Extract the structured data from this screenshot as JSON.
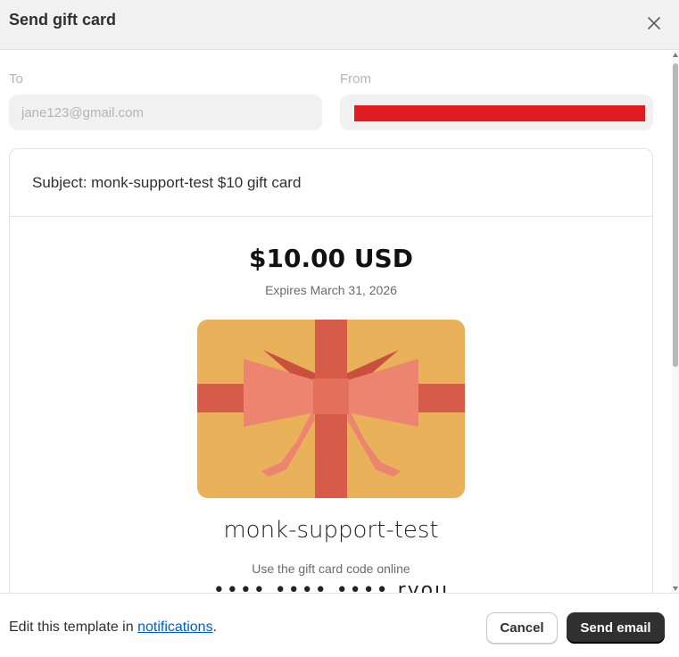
{
  "modal": {
    "title": "Send gift card",
    "close_icon": "close-icon"
  },
  "form": {
    "to_label": "To",
    "to_value": "jane123@gmail.com",
    "from_label": "From",
    "from_value_redacted": true
  },
  "email_preview": {
    "subject": "Subject: monk-support-test $10 gift card",
    "amount": "$10.00 USD",
    "expires": "Expires March 31, 2026",
    "store_name": "monk-support-test",
    "instructions": "Use the gift card code online",
    "code": "•••• •••• •••• ryou"
  },
  "footer": {
    "edit_text_prefix": "Edit this template in ",
    "edit_link": "notifications",
    "edit_text_suffix": ".",
    "cancel_label": "Cancel",
    "send_label": "Send email"
  },
  "colors": {
    "gift_card_background": "#e9b15a",
    "ribbon": "#d65c49",
    "bow": "#ec8470",
    "primary_button": "#303030",
    "link": "#005bd3",
    "redaction": "#e11b22"
  }
}
